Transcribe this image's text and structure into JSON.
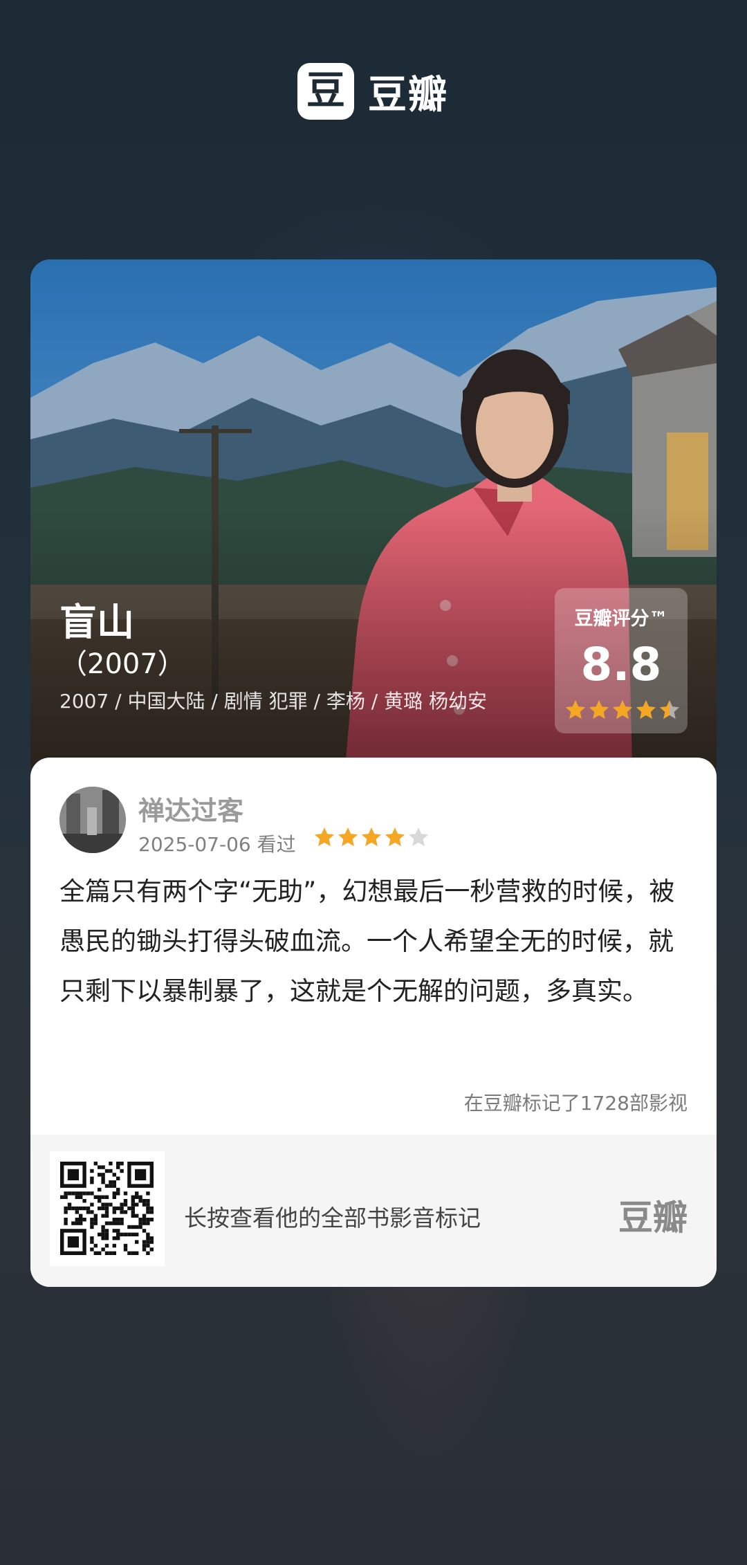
{
  "brand": {
    "icon_glyph": "豆",
    "name": "豆瓣",
    "icon": "douban-logo-icon"
  },
  "movie": {
    "title": "盲山",
    "year": "（2007）",
    "meta": "2007 / 中国大陆 / 剧情 犯罪 / 李杨 / 黄璐 杨幼安",
    "rating_label": "豆瓣评分™",
    "rating_value": "8.8",
    "rating_stars": 4.5
  },
  "review": {
    "user_name": "禅达过客",
    "date_watched": "2025-07-06 看过",
    "user_stars": 4,
    "text": "全篇只有两个字“无助”，幻想最后一秒营救的时候，被愚民的锄头打得头破血流。一个人希望全无的时候，就只剩下以暴制暴了，这就是个无解的问题，多真实。",
    "mark_count": "在豆瓣标记了1728部影视"
  },
  "footer": {
    "hint": "长按查看他的全部书影音标记",
    "logo": "豆瓣",
    "qr_icon": "qr-code-icon"
  },
  "colors": {
    "star_gold": "#f5a623",
    "star_empty": "#d8d8d8",
    "background": "#1f2d38"
  }
}
